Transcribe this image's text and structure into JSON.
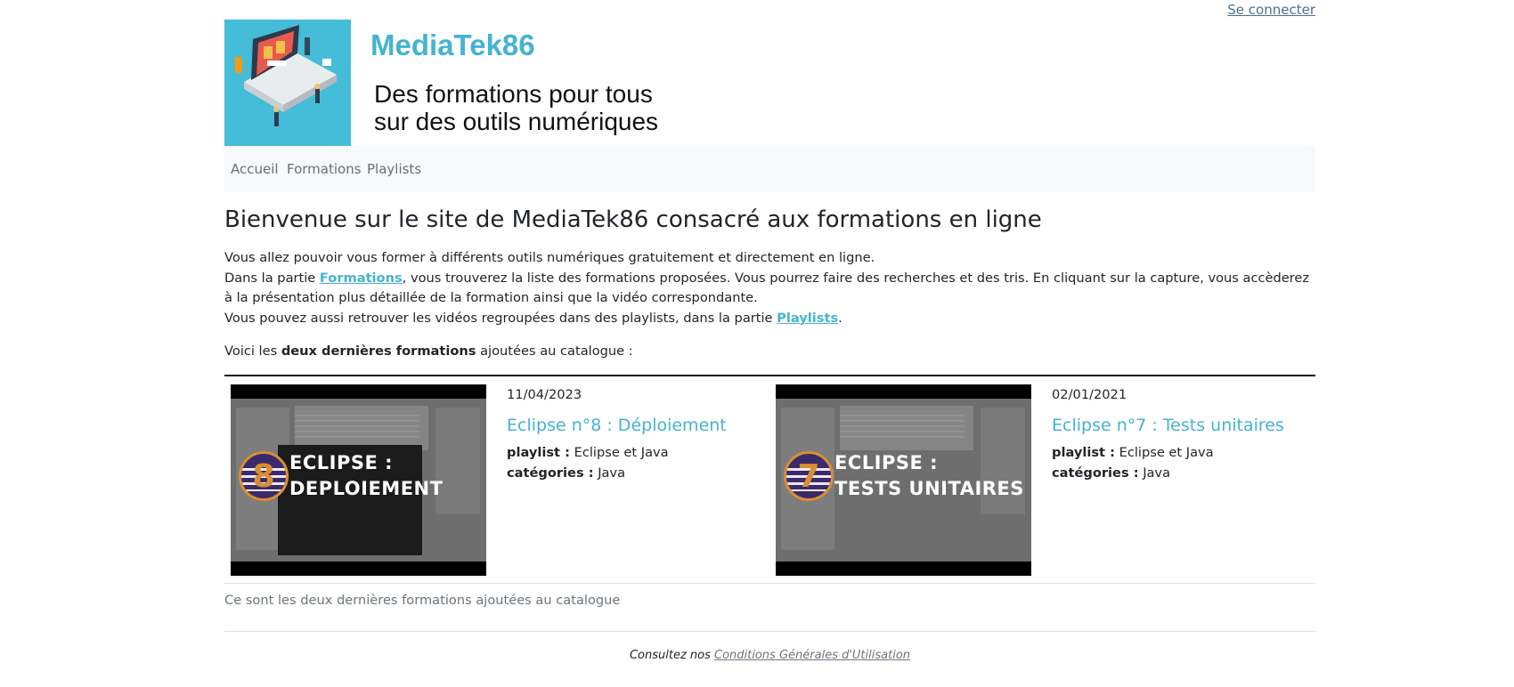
{
  "header": {
    "login_link": "Se connecter",
    "site_title": "MediaTek86",
    "tagline_line1": "Des formations pour tous",
    "tagline_line2": "sur des outils numériques"
  },
  "nav": {
    "items": [
      {
        "label": "Accueil"
      },
      {
        "label": "Formations"
      },
      {
        "label": "Playlists"
      }
    ]
  },
  "main": {
    "heading": "Bienvenue sur le site de MediaTek86 consacré aux formations en ligne",
    "intro_line1": "Vous allez pouvoir vous former à différents outils numériques gratuitement et directement en ligne.",
    "intro_line2_pre": "Dans la partie ",
    "intro_line2_link": "Formations",
    "intro_line2_post": ", vous trouverez la liste des formations proposées. Vous pourrez faire des recherches et des tris. En cliquant sur la capture, vous accèderez à la présentation plus détaillée de la formation ainsi que la vidéo correspondante.",
    "intro_line3_pre": "Vous pouvez aussi retrouver les vidéos regroupées dans des playlists, dans la partie ",
    "intro_line3_link": "Playlists",
    "intro_line3_post": ".",
    "latest_pre": "Voici les ",
    "latest_bold": "deux dernières formations",
    "latest_post": " ajoutées au catalogue :",
    "footer_note": "Ce sont les deux dernières formations ajoutées au catalogue"
  },
  "formations": [
    {
      "date": "11/04/2023",
      "title": "Eclipse n°8 : Déploiement",
      "playlist_label": "playlist :",
      "playlist": "Eclipse et Java",
      "categories_label": "catégories :",
      "categories": "Java",
      "thumb_number": "8",
      "thumb_line1": "ECLIPSE :",
      "thumb_line2": "DEPLOIEMENT"
    },
    {
      "date": "02/01/2021",
      "title": "Eclipse n°7 : Tests unitaires",
      "playlist_label": "playlist :",
      "playlist": "Eclipse et Java",
      "categories_label": "catégories :",
      "categories": "Java",
      "thumb_number": "7",
      "thumb_line1": "ECLIPSE :",
      "thumb_line2": "TESTS UNITAIRES"
    }
  ],
  "footer": {
    "cgu_pre": "Consultez nos ",
    "cgu_link": "Conditions Générales d'Utilisation"
  },
  "colors": {
    "accent": "#45b3d1",
    "logo_bg": "#45bcd8",
    "navbar_bg": "#f8f9fa",
    "text": "#212529",
    "muted": "#6c757d"
  }
}
